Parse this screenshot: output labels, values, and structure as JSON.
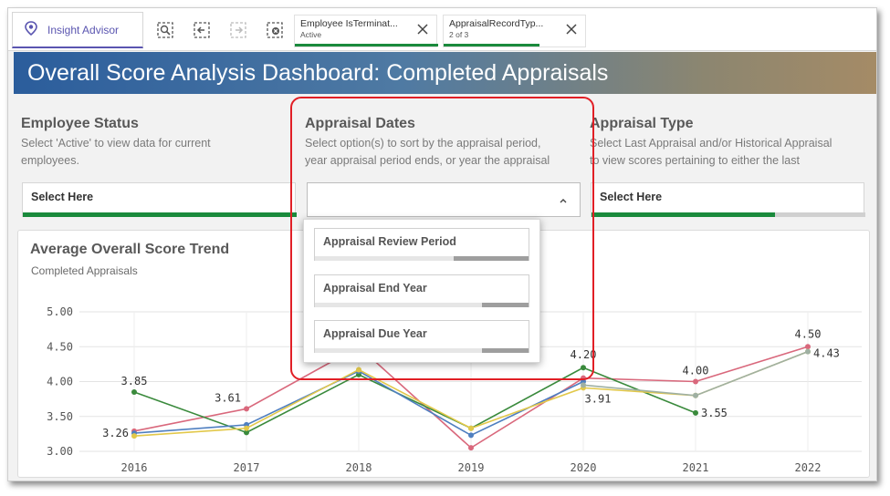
{
  "toolbar": {
    "insight_advisor_label": "Insight Advisor",
    "selections": [
      {
        "field": "Employee IsTerminat...",
        "value": "Active"
      },
      {
        "field": "AppraisalRecordTyp...",
        "value": "2 of 3"
      }
    ]
  },
  "header": {
    "title": "Overall Score Analysis Dashboard: Completed Appraisals"
  },
  "filters": {
    "employee_status": {
      "title": "Employee Status",
      "desc1": "Select 'Active' to view data for current",
      "desc2": "employees.",
      "select_label": "Select Here"
    },
    "appraisal_dates": {
      "title": "Appraisal Dates",
      "desc1": "Select option(s) to sort by the appraisal period,",
      "desc2": "year appraisal period ends, or year the appraisal",
      "select_label": "",
      "options": [
        {
          "label": "Appraisal Review Period",
          "selected_fraction": 0.4
        },
        {
          "label": "Appraisal End Year",
          "selected_fraction": 0.22
        },
        {
          "label": "Appraisal Due Year",
          "selected_fraction": 0.22
        }
      ]
    },
    "appraisal_type": {
      "title": "Appraisal Type",
      "desc1": "Select Last Appraisal and/or Historical Appraisal",
      "desc2": "to view scores pertaining to either the last",
      "select_label": "Select Here",
      "selected_fraction": 0.67
    }
  },
  "chart": {
    "title": "Average Overall Score Trend",
    "subtitle": "Completed Appraisals"
  },
  "chart_data": {
    "type": "line",
    "title": "Average Overall Score Trend",
    "subtitle": "Completed Appraisals",
    "categories": [
      "2016",
      "2017",
      "2018",
      "2019",
      "2020",
      "2021",
      "2022"
    ],
    "ylim": [
      3.0,
      5.0
    ],
    "yticks": [
      "3.00",
      "3.50",
      "4.00",
      "4.50",
      "5.00"
    ],
    "grid": true,
    "series": [
      {
        "color": "#d9687c",
        "values": [
          3.29,
          3.61,
          4.5,
          3.05,
          4.05,
          4.0,
          4.5
        ]
      },
      {
        "color": "#3a8a3c",
        "values": [
          3.85,
          3.27,
          4.1,
          3.33,
          4.2,
          3.55,
          null
        ]
      },
      {
        "color": "#4f7fc0",
        "values": [
          3.26,
          3.38,
          4.15,
          3.23,
          4.0,
          null,
          null
        ]
      },
      {
        "color": "#e2c84a",
        "values": [
          3.22,
          3.33,
          4.17,
          3.33,
          3.91,
          3.8,
          4.43
        ]
      },
      {
        "color": "#9fb0a3",
        "values": [
          null,
          null,
          null,
          null,
          3.95,
          3.8,
          4.43
        ]
      }
    ],
    "data_labels": [
      {
        "x": "2016",
        "text": "3.85"
      },
      {
        "x": "2016",
        "text": "3.26"
      },
      {
        "x": "2017",
        "text": "3.61"
      },
      {
        "x": "2020",
        "text": "4.20"
      },
      {
        "x": "2020",
        "text": "3.91"
      },
      {
        "x": "2021",
        "text": "4.00"
      },
      {
        "x": "2021",
        "text": "3.55"
      },
      {
        "x": "2022",
        "text": "4.50"
      },
      {
        "x": "2022",
        "text": "4.43"
      }
    ]
  }
}
